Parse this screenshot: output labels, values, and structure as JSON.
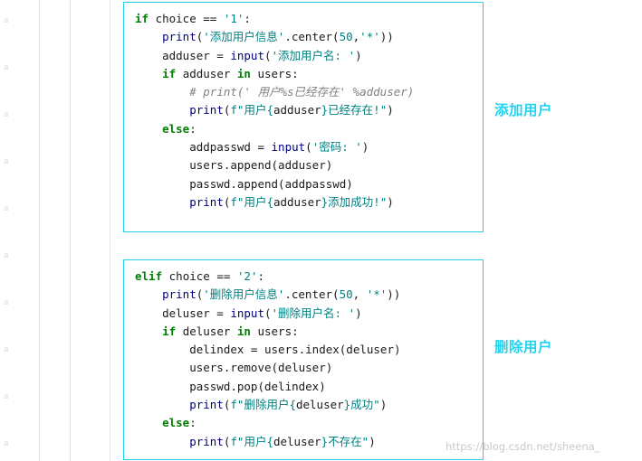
{
  "gutter": {
    "marks": [
      "a",
      "a",
      "a",
      "a",
      "a",
      "a",
      "a",
      "a",
      "a",
      "a"
    ]
  },
  "blocks": [
    {
      "name": "add-user-code-block",
      "annotation": "添加用户",
      "lines": [
        [
          {
            "t": "if ",
            "c": "kw"
          },
          {
            "t": "choice == ",
            "c": "plain"
          },
          {
            "t": "'1'",
            "c": "str"
          },
          {
            "t": ":",
            "c": "plain"
          }
        ],
        [
          {
            "t": "    ",
            "c": "plain"
          },
          {
            "t": "print",
            "c": "fn"
          },
          {
            "t": "(",
            "c": "plain"
          },
          {
            "t": "'添加用户信息'",
            "c": "str"
          },
          {
            "t": ".center(",
            "c": "plain"
          },
          {
            "t": "50",
            "c": "num"
          },
          {
            "t": ",",
            "c": "plain"
          },
          {
            "t": "'*'",
            "c": "str"
          },
          {
            "t": "))",
            "c": "plain"
          }
        ],
        [
          {
            "t": "    adduser = ",
            "c": "plain"
          },
          {
            "t": "input",
            "c": "fn"
          },
          {
            "t": "(",
            "c": "plain"
          },
          {
            "t": "'添加用户名: '",
            "c": "str"
          },
          {
            "t": ")",
            "c": "plain"
          }
        ],
        [
          {
            "t": "    ",
            "c": "plain"
          },
          {
            "t": "if ",
            "c": "kw"
          },
          {
            "t": "adduser ",
            "c": "plain"
          },
          {
            "t": "in ",
            "c": "kw"
          },
          {
            "t": "users:",
            "c": "plain"
          }
        ],
        [
          {
            "t": "        ",
            "c": "plain"
          },
          {
            "t": "# print(' 用户%s已经存在' %adduser)",
            "c": "com"
          }
        ],
        [
          {
            "t": "        ",
            "c": "plain"
          },
          {
            "t": "print",
            "c": "fn"
          },
          {
            "t": "(",
            "c": "plain"
          },
          {
            "t": "f\"用户{",
            "c": "fstr"
          },
          {
            "t": "adduser",
            "c": "plain"
          },
          {
            "t": "}已经存在!\"",
            "c": "fstr"
          },
          {
            "t": ")",
            "c": "plain"
          }
        ],
        [
          {
            "t": "    ",
            "c": "plain"
          },
          {
            "t": "else",
            "c": "kw"
          },
          {
            "t": ":",
            "c": "plain"
          }
        ],
        [
          {
            "t": "        addpasswd = ",
            "c": "plain"
          },
          {
            "t": "input",
            "c": "fn"
          },
          {
            "t": "(",
            "c": "plain"
          },
          {
            "t": "'密码: '",
            "c": "str"
          },
          {
            "t": ")",
            "c": "plain"
          }
        ],
        [
          {
            "t": "        users.append(adduser)",
            "c": "plain"
          }
        ],
        [
          {
            "t": "        passwd.append(addpasswd)",
            "c": "plain"
          }
        ],
        [
          {
            "t": "        ",
            "c": "plain"
          },
          {
            "t": "print",
            "c": "fn"
          },
          {
            "t": "(",
            "c": "plain"
          },
          {
            "t": "f\"用户{",
            "c": "fstr"
          },
          {
            "t": "adduser",
            "c": "plain"
          },
          {
            "t": "}添加成功!\"",
            "c": "fstr"
          },
          {
            "t": ")",
            "c": "plain"
          }
        ]
      ]
    },
    {
      "name": "delete-user-code-block",
      "annotation": "删除用户",
      "lines": [
        [
          {
            "t": "elif ",
            "c": "kw"
          },
          {
            "t": "choice == ",
            "c": "plain"
          },
          {
            "t": "'2'",
            "c": "str"
          },
          {
            "t": ":",
            "c": "plain"
          }
        ],
        [
          {
            "t": "    ",
            "c": "plain"
          },
          {
            "t": "print",
            "c": "fn"
          },
          {
            "t": "(",
            "c": "plain"
          },
          {
            "t": "'删除用户信息'",
            "c": "str"
          },
          {
            "t": ".center(",
            "c": "plain"
          },
          {
            "t": "50",
            "c": "num"
          },
          {
            "t": ", ",
            "c": "plain"
          },
          {
            "t": "'*'",
            "c": "str"
          },
          {
            "t": "))",
            "c": "plain"
          }
        ],
        [
          {
            "t": "    deluser = ",
            "c": "plain"
          },
          {
            "t": "input",
            "c": "fn"
          },
          {
            "t": "(",
            "c": "plain"
          },
          {
            "t": "'删除用户名: '",
            "c": "str"
          },
          {
            "t": ")",
            "c": "plain"
          }
        ],
        [
          {
            "t": "    ",
            "c": "plain"
          },
          {
            "t": "if ",
            "c": "kw"
          },
          {
            "t": "deluser ",
            "c": "plain"
          },
          {
            "t": "in ",
            "c": "kw"
          },
          {
            "t": "users:",
            "c": "plain"
          }
        ],
        [
          {
            "t": "        delindex = users.index(deluser)",
            "c": "plain"
          }
        ],
        [
          {
            "t": "        users.remove(deluser)",
            "c": "plain"
          }
        ],
        [
          {
            "t": "        passwd.pop(delindex)",
            "c": "plain"
          }
        ],
        [
          {
            "t": "        ",
            "c": "plain"
          },
          {
            "t": "print",
            "c": "fn"
          },
          {
            "t": "(",
            "c": "plain"
          },
          {
            "t": "f\"删除用户{",
            "c": "fstr"
          },
          {
            "t": "deluser",
            "c": "plain"
          },
          {
            "t": "}成功\"",
            "c": "fstr"
          },
          {
            "t": ")",
            "c": "plain"
          }
        ],
        [
          {
            "t": "    ",
            "c": "plain"
          },
          {
            "t": "else",
            "c": "kw"
          },
          {
            "t": ":",
            "c": "plain"
          }
        ],
        [
          {
            "t": "        ",
            "c": "plain"
          },
          {
            "t": "print",
            "c": "fn"
          },
          {
            "t": "(",
            "c": "plain"
          },
          {
            "t": "f\"用户{",
            "c": "fstr"
          },
          {
            "t": "deluser",
            "c": "plain"
          },
          {
            "t": "}不存在\"",
            "c": "fstr"
          },
          {
            "t": ")",
            "c": "plain"
          }
        ]
      ]
    }
  ],
  "watermark": "https://blog.csdn.net/sheena_",
  "colors": {
    "accent": "#22d3ee",
    "keyword": "#008000",
    "string": "#008080",
    "function": "#000080",
    "comment": "#808080"
  }
}
